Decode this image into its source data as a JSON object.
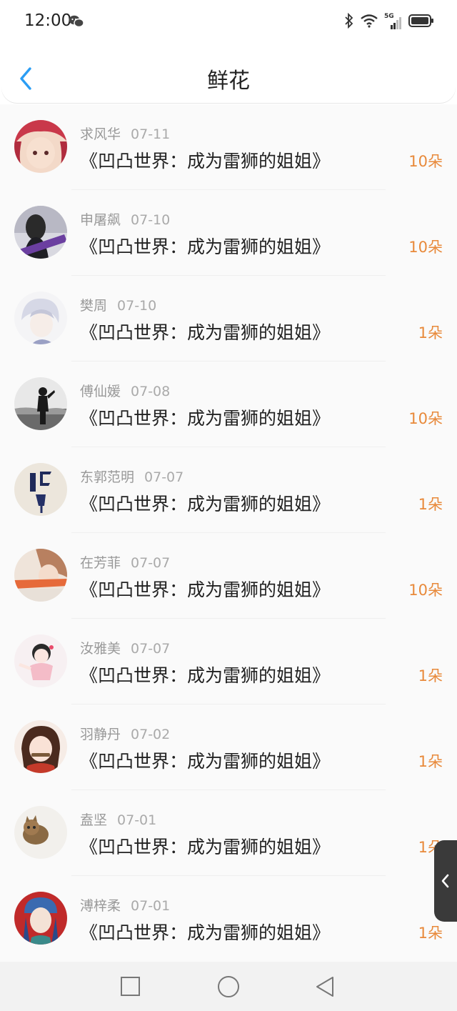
{
  "status_bar": {
    "time": "12:00",
    "network": "5G",
    "icons": [
      "wechat-icon",
      "bluetooth-icon",
      "wifi-icon",
      "signal-icon",
      "battery-icon"
    ]
  },
  "header": {
    "title": "鲜花",
    "back_icon": "chevron-left-icon"
  },
  "colors": {
    "accent_back": "#2a9df4",
    "flower_count": "#e8893a",
    "name_gray": "#999999"
  },
  "records": [
    {
      "name": "求风华",
      "date": "07-11",
      "book": "《凹凸世界：成为雷狮的姐姐》",
      "count": "10朵"
    },
    {
      "name": "申屠飙",
      "date": "07-10",
      "book": "《凹凸世界：成为雷狮的姐姐》",
      "count": "10朵"
    },
    {
      "name": "樊周",
      "date": "07-10",
      "book": "《凹凸世界：成为雷狮的姐姐》",
      "count": "1朵"
    },
    {
      "name": "傅仙媛",
      "date": "07-08",
      "book": "《凹凸世界：成为雷狮的姐姐》",
      "count": "10朵"
    },
    {
      "name": "东郭范明",
      "date": "07-07",
      "book": "《凹凸世界：成为雷狮的姐姐》",
      "count": "1朵"
    },
    {
      "name": "在芳菲",
      "date": "07-07",
      "book": "《凹凸世界：成为雷狮的姐姐》",
      "count": "10朵"
    },
    {
      "name": "汝雅美",
      "date": "07-07",
      "book": "《凹凸世界：成为雷狮的姐姐》",
      "count": "1朵"
    },
    {
      "name": "羽静丹",
      "date": "07-02",
      "book": "《凹凸世界：成为雷狮的姐姐》",
      "count": "1朵"
    },
    {
      "name": "盍坚",
      "date": "07-01",
      "book": "《凹凸世界：成为雷狮的姐姐》",
      "count": "1朵"
    },
    {
      "name": "溥梓柔",
      "date": "07-01",
      "book": "《凹凸世界：成为雷狮的姐姐》",
      "count": "1朵"
    }
  ],
  "system_nav": {
    "icons": [
      "recent-apps-square-icon",
      "home-circle-icon",
      "back-triangle-icon"
    ]
  }
}
